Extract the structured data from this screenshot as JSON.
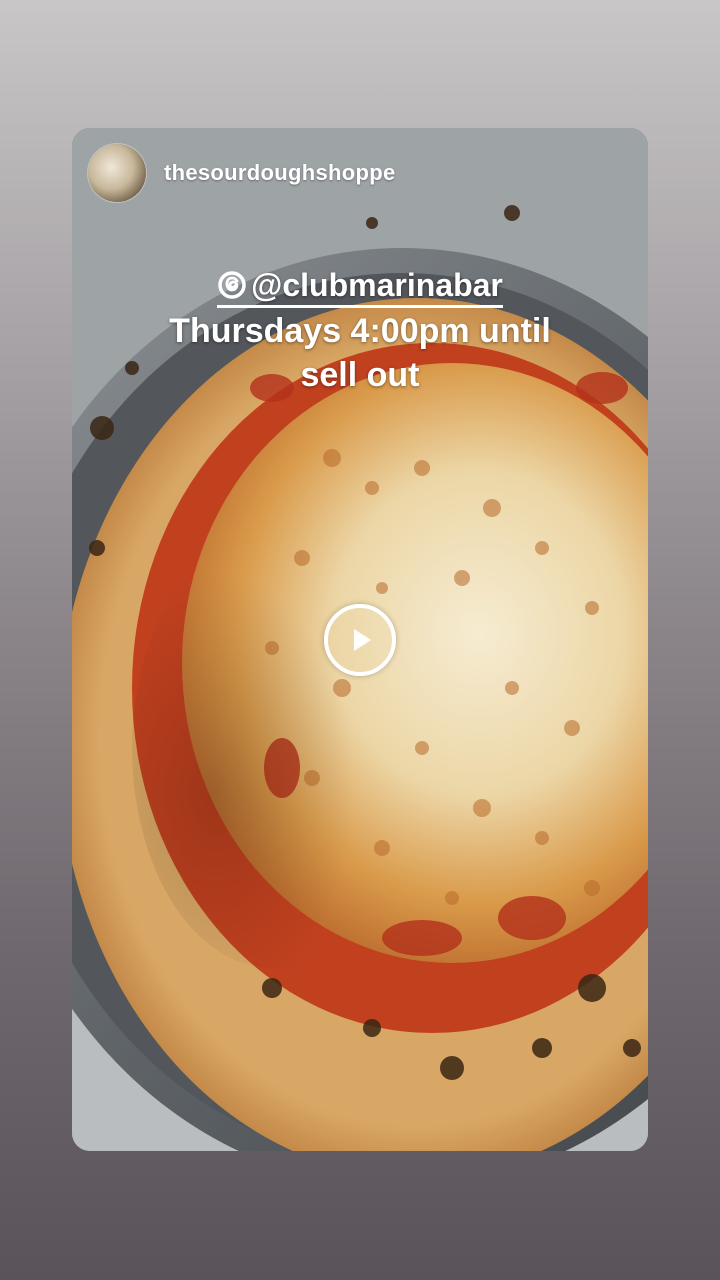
{
  "story": {
    "username": "thesourdoughshoppe",
    "avatar_icon": "avatar-photo",
    "caption": {
      "mention": "@clubmarinabar",
      "line1": "Thursdays 4:00pm until",
      "line2": "sell out"
    },
    "media": {
      "type": "video",
      "subject": "pizza",
      "play_icon": "play-icon"
    }
  },
  "colors": {
    "background_top": "#c9c6c7",
    "background_bottom": "#5a545a",
    "text": "#ffffff"
  }
}
